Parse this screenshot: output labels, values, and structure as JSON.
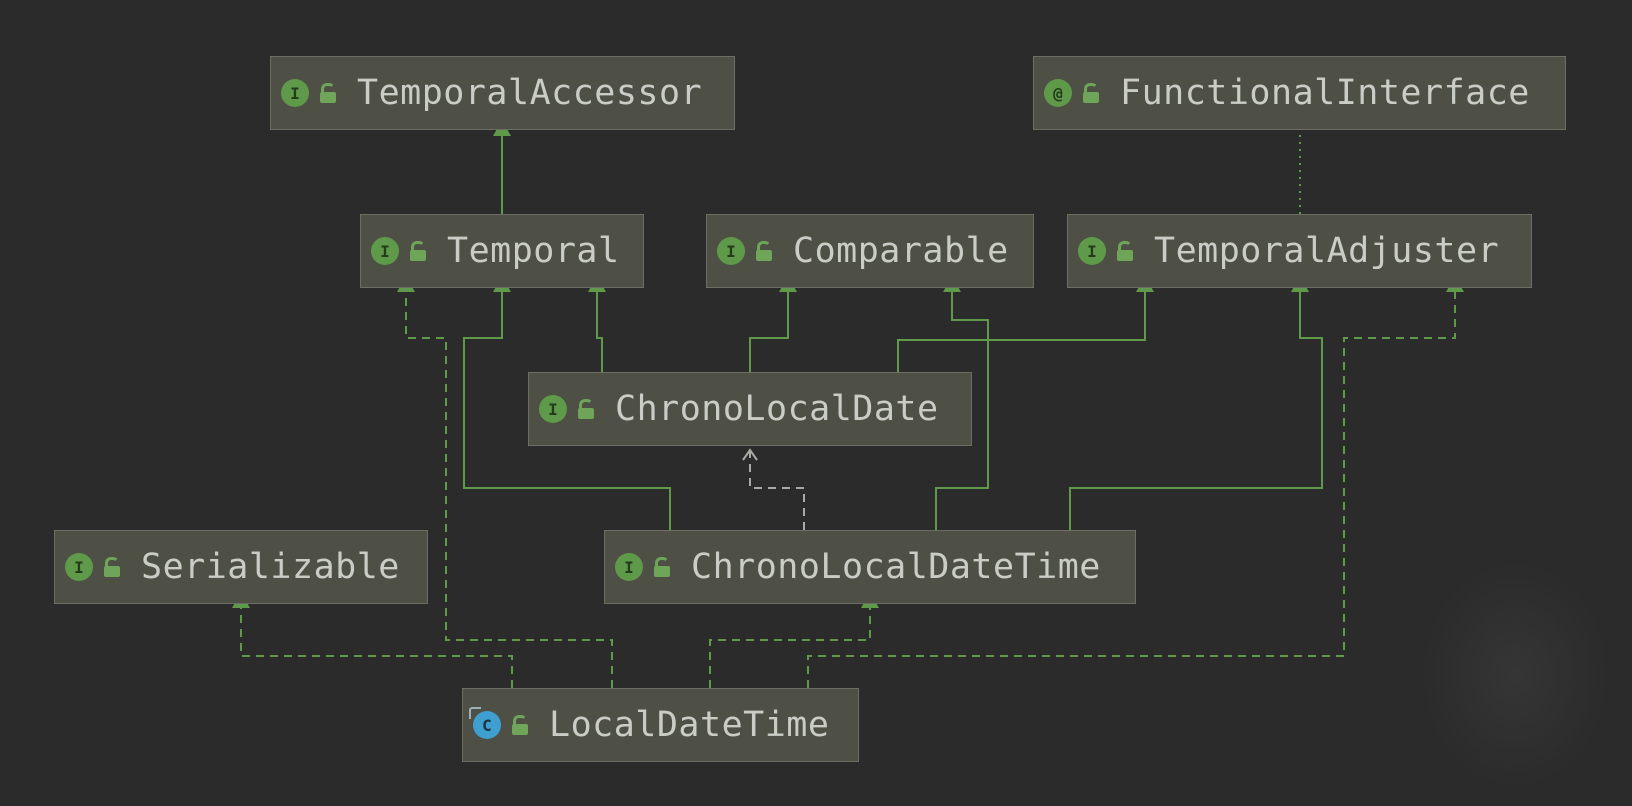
{
  "diagram": {
    "nodes": [
      {
        "id": "TemporalAccessor",
        "label": "TemporalAccessor",
        "kind": "interface",
        "badge": "I",
        "icon": "unlocked-icon"
      },
      {
        "id": "FunctionalInterface",
        "label": "FunctionalInterface",
        "kind": "annotation",
        "badge": "@",
        "icon": "unlocked-icon"
      },
      {
        "id": "Temporal",
        "label": "Temporal",
        "kind": "interface",
        "badge": "I",
        "icon": "unlocked-icon"
      },
      {
        "id": "Comparable",
        "label": "Comparable",
        "kind": "interface",
        "badge": "I",
        "icon": "unlocked-icon"
      },
      {
        "id": "TemporalAdjuster",
        "label": "TemporalAdjuster",
        "kind": "interface",
        "badge": "I",
        "icon": "unlocked-icon"
      },
      {
        "id": "ChronoLocalDate",
        "label": "ChronoLocalDate",
        "kind": "interface",
        "badge": "I",
        "icon": "unlocked-icon"
      },
      {
        "id": "Serializable",
        "label": "Serializable",
        "kind": "interface",
        "badge": "I",
        "icon": "unlocked-icon"
      },
      {
        "id": "ChronoLocalDateTime",
        "label": "ChronoLocalDateTime",
        "kind": "interface",
        "badge": "I",
        "icon": "unlocked-icon"
      },
      {
        "id": "LocalDateTime",
        "label": "LocalDateTime",
        "kind": "class",
        "badge": "C",
        "icon": "unlocked-icon"
      }
    ],
    "edges": [
      {
        "from": "Temporal",
        "to": "TemporalAccessor",
        "type": "extends"
      },
      {
        "from": "TemporalAdjuster",
        "to": "FunctionalInterface",
        "type": "annotated"
      },
      {
        "from": "ChronoLocalDate",
        "to": "Temporal",
        "type": "extends"
      },
      {
        "from": "ChronoLocalDate",
        "to": "Comparable",
        "type": "extends"
      },
      {
        "from": "ChronoLocalDate",
        "to": "TemporalAdjuster",
        "type": "extends"
      },
      {
        "from": "ChronoLocalDateTime",
        "to": "Temporal",
        "type": "extends"
      },
      {
        "from": "ChronoLocalDateTime",
        "to": "Comparable",
        "type": "extends"
      },
      {
        "from": "ChronoLocalDateTime",
        "to": "TemporalAdjuster",
        "type": "extends"
      },
      {
        "from": "ChronoLocalDateTime",
        "to": "ChronoLocalDate",
        "type": "dependency"
      },
      {
        "from": "LocalDateTime",
        "to": "Serializable",
        "type": "implements"
      },
      {
        "from": "LocalDateTime",
        "to": "Temporal",
        "type": "implements"
      },
      {
        "from": "LocalDateTime",
        "to": "ChronoLocalDateTime",
        "type": "implements"
      },
      {
        "from": "LocalDateTime",
        "to": "TemporalAdjuster",
        "type": "implements"
      }
    ]
  },
  "colors": {
    "background": "#2b2b2b",
    "node_fill": "#4e5046",
    "node_border": "#6d6f64",
    "text": "#c9cdc6",
    "edge": "#5e9a49",
    "dependency_edge": "#a9aaa5",
    "interface_badge": "#5e9a49",
    "class_badge": "#3f9fd1"
  }
}
